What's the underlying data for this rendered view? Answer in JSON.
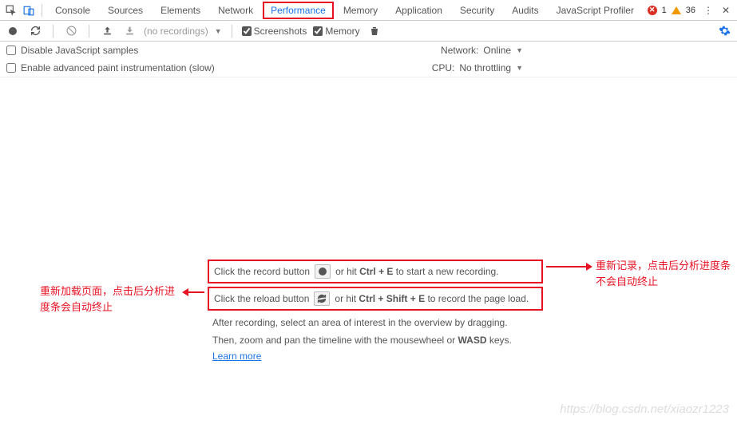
{
  "tabs": [
    "Console",
    "Sources",
    "Elements",
    "Network",
    "Performance",
    "Memory",
    "Application",
    "Security",
    "Audits",
    "JavaScript Profiler"
  ],
  "activeTab": "Performance",
  "errors": {
    "error_count": "1",
    "warning_count": "36"
  },
  "toolbar": {
    "no_recordings": "(no recordings)",
    "screenshots": "Screenshots",
    "memory": "Memory"
  },
  "options": {
    "disable_js": "Disable JavaScript samples",
    "enable_paint": "Enable advanced paint instrumentation (slow)",
    "network_label": "Network:",
    "network_value": "Online",
    "cpu_label": "CPU:",
    "cpu_value": "No throttling"
  },
  "instructions": {
    "line1_pre": "Click the record button",
    "line1_post_a": "or hit ",
    "line1_shortcut": "Ctrl + E",
    "line1_post_b": " to start a new recording.",
    "line2_pre": "Click the reload button",
    "line2_post_a": "or hit ",
    "line2_shortcut": "Ctrl + Shift + E",
    "line2_post_b": " to record the page load.",
    "after1": "After recording, select an area of interest in the overview by dragging.",
    "after2_a": "Then, zoom and pan the timeline with the mousewheel or ",
    "after2_b": "WASD",
    "after2_c": " keys.",
    "learn_more": "Learn more"
  },
  "annotations": {
    "right": "重新记录，点击后分析进度条不会自动终止",
    "left": "重新加载页面，点击后分析进度条会自动终止"
  },
  "watermark": "https://blog.csdn.net/xiaozr1223"
}
